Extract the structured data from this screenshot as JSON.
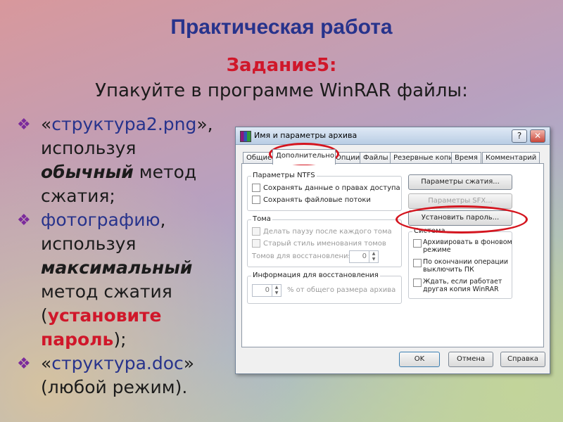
{
  "slide": {
    "title": "Практическая работа",
    "task_title": "Задание5:",
    "task_text": "Упакуйте в программе WinRAR файлы:",
    "bullets": [
      {
        "prefix": "«",
        "name": "структура2.png",
        "suffix": "», используя ",
        "method": "обычный",
        "after": " метод сжатия;"
      },
      {
        "name": "фотографию",
        "suffix": ", используя ",
        "method": "максимальный",
        "after": " метод сжатия (",
        "accent": "установите пароль",
        "tail": ");"
      },
      {
        "prefix": "«",
        "name": "структура.doc",
        "suffix": "» (любой режим)."
      }
    ],
    "colors": {
      "title": "#27338c",
      "accent": "#d0172a",
      "bullet_marker": "#7b2a9c"
    }
  },
  "dialog": {
    "title": "Имя и параметры архива",
    "controls": {
      "help": "?",
      "close": "✕"
    },
    "tabs": [
      "Общие",
      "Дополнительно",
      "Опции",
      "Файлы",
      "Резервные копии",
      "Время",
      "Комментарий"
    ],
    "active_tab": "Дополнительно",
    "ntfs": {
      "label": "Параметры NTFS",
      "options": [
        "Сохранять данные о правах доступа",
        "Сохранять файловые потоки"
      ]
    },
    "volumes": {
      "label": "Тома",
      "options": [
        "Делать паузу после каждого тома",
        "Старый стиль именования томов"
      ],
      "recovery_volumes_label": "Томов для восстановления:",
      "recovery_volumes_value": "0"
    },
    "recovery": {
      "label": "Информация для восстановления",
      "value": "0",
      "unit_label": "% от общего размера архива"
    },
    "buttons": {
      "compression": "Параметры сжатия...",
      "sfx": "Параметры SFX...",
      "password": "Установить пароль..."
    },
    "system": {
      "label": "Система",
      "options": [
        "Архивировать в фоновом режиме",
        "По окончании операции выключить ПК",
        "Ждать, если работает другая копия WinRAR"
      ]
    },
    "footer": {
      "ok": "OK",
      "cancel": "Отмена",
      "help": "Справка"
    }
  }
}
